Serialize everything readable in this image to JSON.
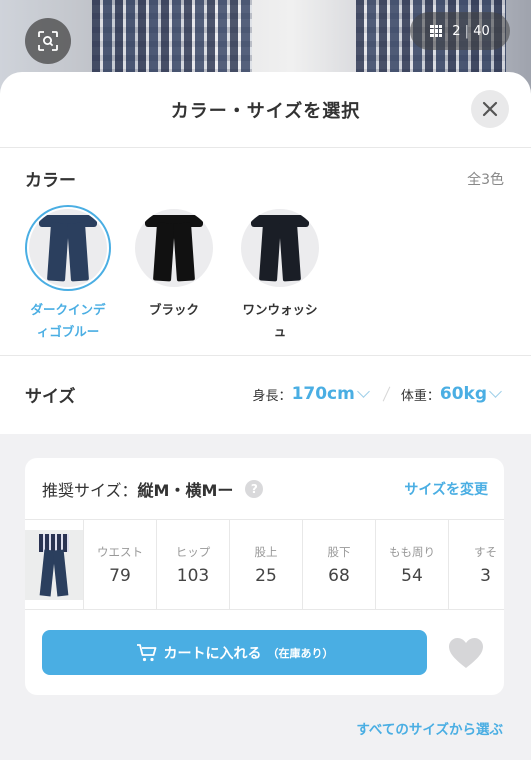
{
  "photo": {
    "counter_current": "2",
    "counter_total": "40"
  },
  "sheet": {
    "title": "カラー・サイズを選択"
  },
  "color": {
    "title": "カラー",
    "count": "全3色",
    "options": [
      {
        "label_line1": "ダークインデ",
        "label_line2": "ィゴブルー",
        "selected": true,
        "tone": "#2b3f5e"
      },
      {
        "label_line1": "ブラック",
        "label_line2": "",
        "selected": false,
        "tone": "#111111"
      },
      {
        "label_line1": "ワンウォッシ",
        "label_line2": "ュ",
        "selected": false,
        "tone": "#1a1e26"
      }
    ]
  },
  "size": {
    "title": "サイズ",
    "height_label": "身長：",
    "height_value": "170cm",
    "weight_label": "体重：",
    "weight_value": "60kg"
  },
  "recommend": {
    "label": "推奨サイズ：",
    "value": "縦M・横Mー",
    "help": "?",
    "change_link": "サイズを変更",
    "measures": [
      {
        "label": "ウエスト",
        "value": "79"
      },
      {
        "label": "ヒップ",
        "value": "103"
      },
      {
        "label": "股上",
        "value": "25"
      },
      {
        "label": "股下",
        "value": "68"
      },
      {
        "label": "もも周り",
        "value": "54"
      },
      {
        "label": "すそ",
        "value": "3"
      }
    ],
    "cart_label": "カートに入れる",
    "cart_sub": "（在庫あり）"
  },
  "footer": {
    "all_sizes_link": "すべてのサイズから選ぶ"
  },
  "colors": {
    "accent": "#4aaee3"
  }
}
